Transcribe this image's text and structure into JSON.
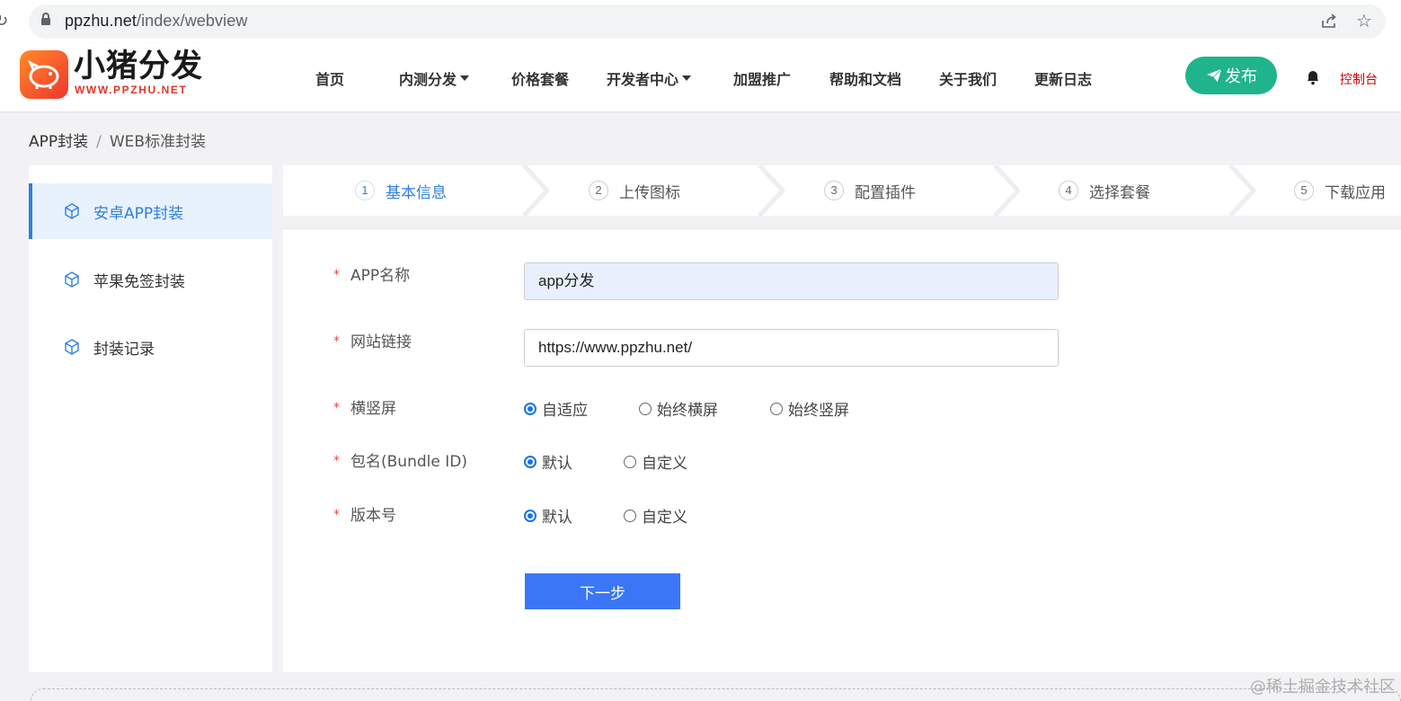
{
  "browser": {
    "url_host": "ppzhu.net",
    "url_path": "/index/webview"
  },
  "header": {
    "brand_title": "小猪分发",
    "brand_sub": "WWW.PPZHU.NET",
    "nav": [
      {
        "label": "首页",
        "has_caret": false
      },
      {
        "label": "内测分发",
        "has_caret": true
      },
      {
        "label": "价格套餐",
        "has_caret": false
      },
      {
        "label": "开发者中心",
        "has_caret": true
      },
      {
        "label": "加盟推广",
        "has_caret": false
      },
      {
        "label": "帮助和文档",
        "has_caret": false
      },
      {
        "label": "关于我们",
        "has_caret": false
      },
      {
        "label": "更新日志",
        "has_caret": false
      }
    ],
    "publish_label": "发布",
    "console_label": "控制台"
  },
  "breadcrumb": {
    "items": [
      "APP封装",
      "WEB标准封装"
    ],
    "separator": "/"
  },
  "sidebar": {
    "items": [
      {
        "label": "安卓APP封装",
        "active": true
      },
      {
        "label": "苹果免签封装",
        "active": false
      },
      {
        "label": "封装记录",
        "active": false
      }
    ]
  },
  "steps": [
    {
      "num": "1",
      "label": "基本信息",
      "active": true
    },
    {
      "num": "2",
      "label": "上传图标",
      "active": false
    },
    {
      "num": "3",
      "label": "配置插件",
      "active": false
    },
    {
      "num": "4",
      "label": "选择套餐",
      "active": false
    },
    {
      "num": "5",
      "label": "下载应用",
      "active": false
    }
  ],
  "form": {
    "required_mark": "*",
    "app_name": {
      "label": "APP名称",
      "value": "app分发"
    },
    "site_url": {
      "label": "网站链接",
      "value": "https://www.ppzhu.net/"
    },
    "orientation": {
      "label": "横竖屏",
      "options": [
        "自适应",
        "始终横屏",
        "始终竖屏"
      ],
      "selected": "自适应"
    },
    "bundle_id": {
      "label": "包名(Bundle ID)",
      "options": [
        "默认",
        "自定义"
      ],
      "selected": "默认"
    },
    "version": {
      "label": "版本号",
      "options": [
        "默认",
        "自定义"
      ],
      "selected": "默认"
    },
    "next_label": "下一步"
  },
  "watermark": "@稀土掘金技术社区",
  "colors": {
    "accent": "#2f7fe0",
    "publish_green": "#1fb48c",
    "next_blue": "#3b76f6",
    "logo_orange": "#ff8a2a",
    "logo_red": "#f0362d",
    "required_red": "#e44"
  }
}
